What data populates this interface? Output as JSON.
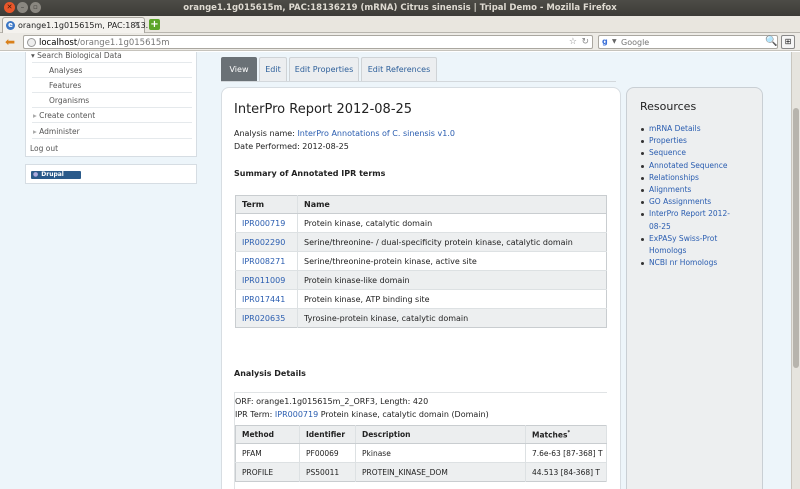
{
  "window": {
    "title": "orange1.1g015615m, PAC:18136219 (mRNA) Citrus sinensis | Tripal Demo - Mozilla Firefox"
  },
  "browser": {
    "tab_label": "orange1.1g015615m, PAC:1813...",
    "url_host": "localhost",
    "url_path": "/orange1.1g015615m",
    "search_placeholder": "Google",
    "search_engine_glyph": "g"
  },
  "sidebar": {
    "items": [
      {
        "label": "Search Biological Data"
      },
      {
        "label": "Analyses"
      },
      {
        "label": "Features"
      },
      {
        "label": "Organisms"
      },
      {
        "label": "Create content"
      },
      {
        "label": "Administer"
      },
      {
        "label": "Log out"
      }
    ],
    "drupal_badge": "Drupal"
  },
  "tabs": [
    {
      "label": "View"
    },
    {
      "label": "Edit"
    },
    {
      "label": "Edit Properties"
    },
    {
      "label": "Edit References"
    }
  ],
  "report": {
    "title": "InterPro Report 2012-08-25",
    "analysis_prefix": "Analysis name: ",
    "analysis_name": "InterPro Annotations of C. sinensis v1.0",
    "date_performed": "Date Performed: 2012-08-25",
    "summary_heading": "Summary of Annotated IPR terms",
    "summary_headers": [
      "Term",
      "Name"
    ],
    "summary_rows": [
      {
        "term": "IPR000719",
        "name": "Protein kinase, catalytic domain"
      },
      {
        "term": "IPR002290",
        "name": "Serine/threonine- / dual-specificity protein kinase, catalytic domain"
      },
      {
        "term": "IPR008271",
        "name": "Serine/threonine-protein kinase, active site"
      },
      {
        "term": "IPR011009",
        "name": "Protein kinase-like domain"
      },
      {
        "term": "IPR017441",
        "name": "Protein kinase, ATP binding site"
      },
      {
        "term": "IPR020635",
        "name": "Tyrosine-protein kinase, catalytic domain"
      }
    ],
    "details_heading": "Analysis Details",
    "orf_line": "ORF: orange1.1g015615m_2_ORF3, Length: 420",
    "ipr_term_prefix": "IPR Term: ",
    "ipr_term_link": "IPR000719",
    "ipr_term_suffix": " Protein kinase, catalytic domain (Domain)",
    "match_headers": [
      "Method",
      "Identifier",
      "Description",
      "Matches"
    ],
    "match_headers_note": "*",
    "match_rows": [
      {
        "method": "PFAM",
        "identifier": "PF00069",
        "description": "Pkinase",
        "matches": "7.6e-63 [87-368] T"
      },
      {
        "method": "PROFILE",
        "identifier": "PS50011",
        "description": "PROTEIN_KINASE_DOM",
        "matches": "44.513 [84-368] T"
      }
    ]
  },
  "resources": {
    "title": "Resources",
    "items": [
      "mRNA Details",
      "Properties",
      "Sequence",
      "Annotated Sequence",
      "Relationships",
      "Alignments",
      "GO Assignments",
      "InterPro Report 2012-08-25",
      "ExPASy Swiss-Prot Homologs",
      "NCBI nr Homologs"
    ]
  },
  "colors": {
    "link": "#2a5db0",
    "active_tab": "#6a7176",
    "page_background": "#edf5fa"
  }
}
